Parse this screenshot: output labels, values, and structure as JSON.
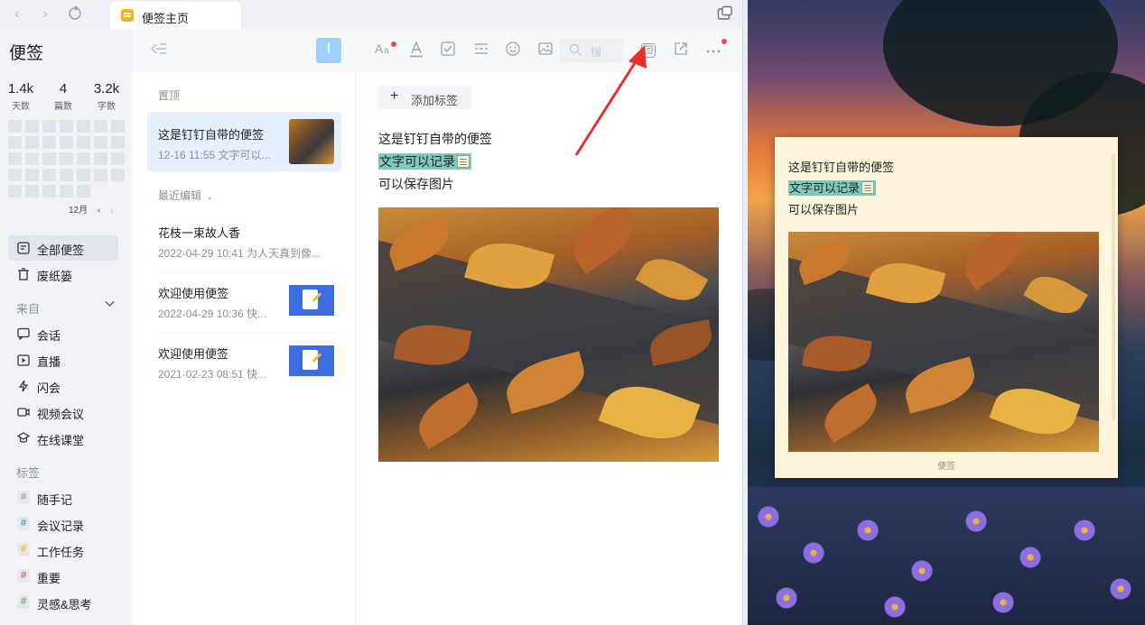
{
  "window": {
    "tab_label": "便签主页",
    "back_icon": "chevron-left-icon",
    "forward_icon": "chevron-right-icon",
    "refresh_icon": "refresh-icon"
  },
  "sidebar": {
    "title": "便签",
    "stats": [
      {
        "value": "1.4k",
        "label": "天数"
      },
      {
        "value": "4",
        "label": "篇数"
      },
      {
        "value": "3.2k",
        "label": "字数"
      }
    ],
    "month": "12月",
    "nav": [
      {
        "label": "全部便签",
        "icon": "note-icon",
        "active": true
      },
      {
        "label": "废纸篓",
        "icon": "trash-icon",
        "active": false
      }
    ],
    "from_label": "来自",
    "from_items": [
      {
        "label": "会话",
        "icon": "chat-icon"
      },
      {
        "label": "直播",
        "icon": "live-icon"
      },
      {
        "label": "闪会",
        "icon": "flash-meeting-icon"
      },
      {
        "label": "视频会议",
        "icon": "video-icon"
      },
      {
        "label": "在线课堂",
        "icon": "classroom-icon"
      }
    ],
    "tags_label": "标签",
    "tags": [
      {
        "label": "随手记",
        "color": "#9aa0a8"
      },
      {
        "label": "会议记录",
        "color": "#3aa0e6"
      },
      {
        "label": "工作任务",
        "color": "#f2b51e"
      },
      {
        "label": "重要",
        "color": "#e65a5a"
      },
      {
        "label": "灵感&思考",
        "color": "#4fb06d"
      }
    ]
  },
  "list": {
    "pinned_label": "置顶",
    "recent_label": "最近编辑",
    "pinned_note": {
      "title": "这是钉钉自带的便签",
      "meta": "12-16 11:55 文字可以..."
    },
    "notes": [
      {
        "title": "花枝一束故人香",
        "meta": "2022-04-29 10:41 为人天真到像..."
      },
      {
        "title": "欢迎使用便签",
        "meta": "2022-04-29 10:36 快..."
      },
      {
        "title": "欢迎使用便签",
        "meta": "2021-02-23 08:51 快..."
      }
    ]
  },
  "editor": {
    "search_placeholder": "搜",
    "add_tag_label": "添加标签",
    "lines": [
      "这是钉钉自带的便签",
      "文字可以记录",
      "可以保存图片"
    ],
    "highlight_color": "#7fc8bd"
  },
  "sticky": {
    "lines": [
      "这是钉钉自带的便签",
      "文字可以记录",
      "可以保存图片"
    ],
    "footer": "便签"
  },
  "colors": {
    "accent": "#9fd0fb",
    "selected_bg": "#e5efff",
    "annotation_arrow": "#e8302a"
  }
}
